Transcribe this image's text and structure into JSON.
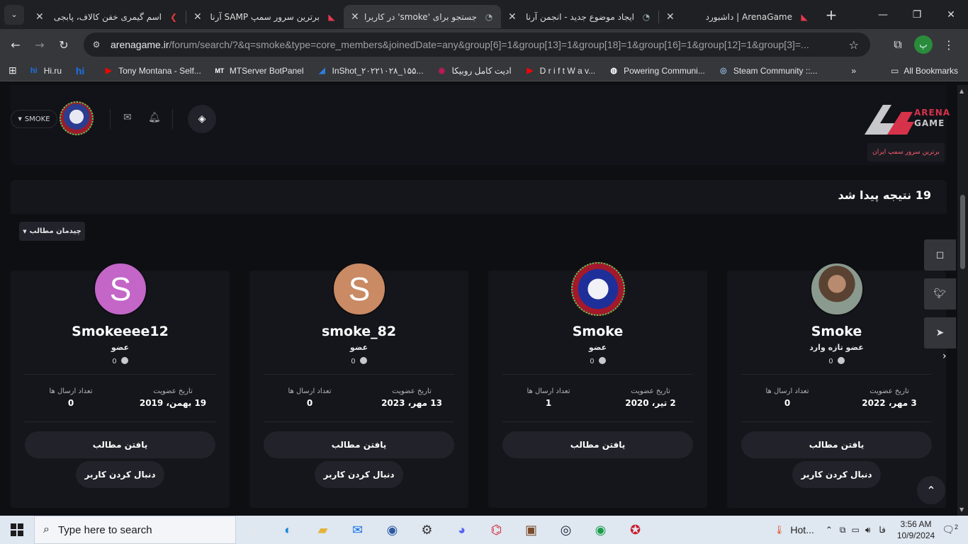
{
  "browser": {
    "tabs": [
      {
        "title": "اسم گیمری خفن کالاف، پابجی",
        "active": false
      },
      {
        "title": "برترین سرور سمپ SAMP آرنا گیم",
        "active": false
      },
      {
        "title": "جستجو برای 'smoke' در کاربران",
        "active": true
      },
      {
        "title": "ایجاد موضوع جدید - انجمن آرنا",
        "active": false
      },
      {
        "title": "ArenaGame | داشبورد",
        "active": false
      }
    ],
    "url_domain": "arenagame.ir",
    "url_path": "/forum/search/?&q=smoke&type=core_members&joinedDate=any&group[6]=1&group[13]=1&group[18]=1&group[16]=1&group[12]=1&group[3]=...",
    "profile_initial": "پ",
    "bookmarks": [
      {
        "label": "Hi.ru",
        "icon": "hi",
        "color": "#1a73e8"
      },
      {
        "label": "",
        "icon": "hi",
        "color": "#1a73e8"
      },
      {
        "label": "Tony Montana - Self...",
        "icon": "youtube-icon",
        "color": "#ff0000"
      },
      {
        "label": "MTServer BotPanel",
        "icon": "MT",
        "color": "#ffffff"
      },
      {
        "label": "InShot_۲۰۲۲۱۰۲۸_۱۵۵...",
        "icon": "inshot-icon",
        "color": "#2d7fe0"
      },
      {
        "label": "ادیت کامل روبیکا",
        "icon": "rubika-icon",
        "color": "#c2185b"
      },
      {
        "label": "D r i f t W a v...",
        "icon": "youtube-icon",
        "color": "#ff0000"
      },
      {
        "label": "Powering Communi...",
        "icon": "globe-icon",
        "color": "#ffffff"
      },
      {
        "label": "Steam Community ::...",
        "icon": "steam-icon",
        "color": "#8fb3d8"
      }
    ],
    "all_bookmarks": "All Bookmarks"
  },
  "header": {
    "username_pill": "SMOKE",
    "logo_line1": "ARENA",
    "logo_line2": "GAME",
    "tagline": "برترین سرور سمپ ایران"
  },
  "results": {
    "title": "19 نتیجه پیدا شد",
    "layout_button": "چیدمان مطالب"
  },
  "members": [
    {
      "name": "Smoke",
      "role": "عضو تازه وارد",
      "reputation": "0",
      "joined_label": "تاریخ عضویت",
      "joined": "3 مهر، 2022",
      "posts_label": "تعداد ارسال ها",
      "posts": "0",
      "find": "یافتن مطالب",
      "follow": "دنبال کردن کاربر",
      "avatar_type": "photo",
      "avatar_letter": ""
    },
    {
      "name": "Smoke",
      "role": "عضو",
      "reputation": "0",
      "joined_label": "تاریخ عضویت",
      "joined": "2 تیر، 2020",
      "posts_label": "تعداد ارسال ها",
      "posts": "1",
      "find": "یافتن مطالب",
      "follow": "",
      "avatar_type": "controller",
      "avatar_letter": ""
    },
    {
      "name": "smoke_82",
      "role": "عضو",
      "reputation": "0",
      "joined_label": "تاریخ عضویت",
      "joined": "13 مهر، 2023",
      "posts_label": "تعداد ارسال ها",
      "posts": "0",
      "find": "یافتن مطالب",
      "follow": "دنبال کردن کاربر",
      "avatar_type": "letter",
      "avatar_letter": "S",
      "avatar_color": "#c98a64"
    },
    {
      "name": "Smokeeee12",
      "role": "عضو",
      "reputation": "0",
      "joined_label": "تاریخ عضویت",
      "joined": "19 بهمن، 2019",
      "posts_label": "تعداد ارسال ها",
      "posts": "0",
      "find": "یافتن مطالب",
      "follow": "دنبال کردن کاربر",
      "avatar_type": "letter",
      "avatar_letter": "S",
      "avatar_color": "#c366c8"
    }
  ],
  "taskbar": {
    "search_placeholder": "Type here to search",
    "weather": "Hot...",
    "lang": "فا",
    "time": "3:56 AM",
    "date": "10/9/2024",
    "notifications": "2"
  }
}
